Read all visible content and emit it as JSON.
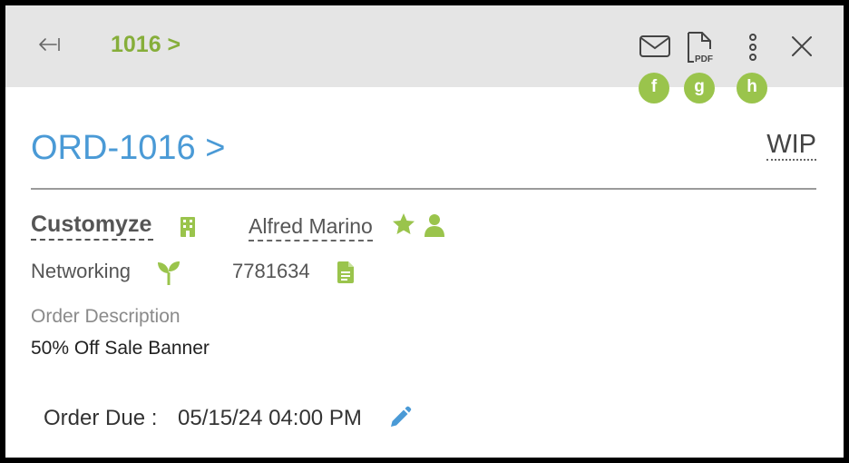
{
  "header": {
    "breadcrumb": "1016 >",
    "icons": {
      "back": "back-arrow-icon",
      "email": "mail-icon",
      "pdf": "pdf-icon",
      "more": "more-vertical-icon",
      "close": "close-icon"
    },
    "hints": [
      "f",
      "g",
      "h"
    ],
    "pdf_text": "PDF"
  },
  "order": {
    "title": "ORD-1016 >",
    "status": "WIP",
    "company": "Customyze",
    "contact": "Alfred Marino",
    "industry": "Networking",
    "code": "7781634",
    "description_label": "Order Description",
    "description": "50% Off Sale Banner",
    "due_label": "Order Due :",
    "due_value": "05/15/24 04:00 PM"
  },
  "colors": {
    "accent_green": "#86ae3a",
    "icon_green": "#9ac44c",
    "link_blue": "#4a9ad6",
    "topbar_bg": "#e5e5e5"
  }
}
